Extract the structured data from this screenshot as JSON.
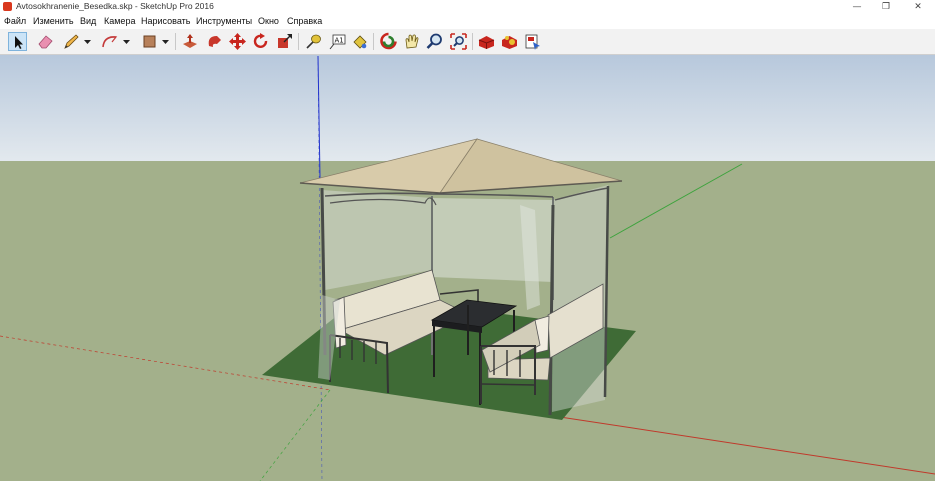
{
  "window": {
    "title": "Avtosokhranenie_Besedka.skp - SketchUp Pro 2016",
    "minimize_glyph": "—",
    "restore_glyph": "❐",
    "close_glyph": "✕"
  },
  "menu": [
    "Файл",
    "Изменить",
    "Вид",
    "Камера",
    "Нарисовать",
    "Инструменты",
    "Окно",
    "Справка"
  ],
  "toolbar": {
    "tools": [
      "select",
      "eraser",
      "pencil",
      "arc",
      "rectangle",
      "push-pull",
      "follow-me",
      "move",
      "rotate",
      "scale",
      "tape-measure",
      "text",
      "paint-bucket",
      "orbit",
      "pan",
      "zoom",
      "zoom-extents",
      "warehouse",
      "extension-warehouse",
      "layout"
    ],
    "active_tool": "select"
  },
  "colors": {
    "sky_top": "#b7c8dc",
    "sky_bottom": "#e3e9ee",
    "ground": "#a3b08b",
    "roof": "#d6c9a8",
    "lawn": "#3f6b36",
    "axis_red": "#c0392b",
    "axis_green": "#3da33d",
    "axis_blue": "#2233cc"
  }
}
